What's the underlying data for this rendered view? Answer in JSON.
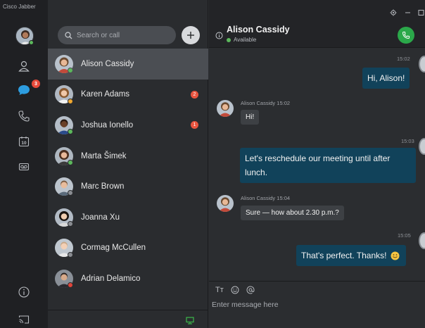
{
  "app": {
    "title": "Cisco Jabber"
  },
  "rail": {
    "chats_badge": "3",
    "calendar_day": "10"
  },
  "search": {
    "placeholder": "Search or call"
  },
  "contacts": [
    {
      "name": "Alison Cassidy",
      "status": "available",
      "selected": true,
      "unread": ""
    },
    {
      "name": "Karen Adams",
      "status": "away",
      "selected": false,
      "unread": "2"
    },
    {
      "name": "Joshua Ionello",
      "status": "available",
      "selected": false,
      "unread": "1"
    },
    {
      "name": "Marta Šimek",
      "status": "available",
      "selected": false,
      "unread": ""
    },
    {
      "name": "Marc Brown",
      "status": "offline",
      "selected": false,
      "unread": ""
    },
    {
      "name": "Joanna Xu",
      "status": "offline",
      "selected": false,
      "unread": ""
    },
    {
      "name": "Cormag McCullen",
      "status": "offline",
      "selected": false,
      "unread": ""
    },
    {
      "name": "Adrian Delamico",
      "status": "busy",
      "selected": false,
      "unread": ""
    }
  ],
  "chat": {
    "contact_name": "Alison Cassidy",
    "contact_status": "Available",
    "messages": [
      {
        "dir": "out",
        "time": "15:02",
        "text": "Hi, Alison!"
      },
      {
        "dir": "in",
        "meta": "Alison Cassidy 15:02",
        "text": "Hi!"
      },
      {
        "dir": "out",
        "time": "15:03",
        "text": "Let's reschedule our meeting until after lunch."
      },
      {
        "dir": "in",
        "meta": "Alison Cassidy 15:04",
        "text": "Sure — how about 2.30 p.m.?"
      },
      {
        "dir": "out",
        "time": "15:05",
        "text": "That's perfect. Thanks!"
      }
    ],
    "composer": {
      "format_label": "Tт",
      "placeholder": "Enter message here"
    }
  },
  "colors": {
    "available": "#5cb85c",
    "away": "#f0a830",
    "busy": "#e0443a",
    "offline": "#8a8d92",
    "accent_bubble": "#11425a",
    "call_green": "#2ba84a",
    "badge_red": "#e84a3a"
  },
  "icons": [
    "contacts-icon",
    "chats-icon",
    "phone-icon",
    "calendar-icon",
    "voicemail-icon",
    "info-icon",
    "cast-icon",
    "search-icon",
    "plus-icon",
    "settings-icon",
    "minimize-icon",
    "maximize-icon",
    "call-icon",
    "emoji-icon",
    "mention-icon",
    "screen-share-icon"
  ]
}
